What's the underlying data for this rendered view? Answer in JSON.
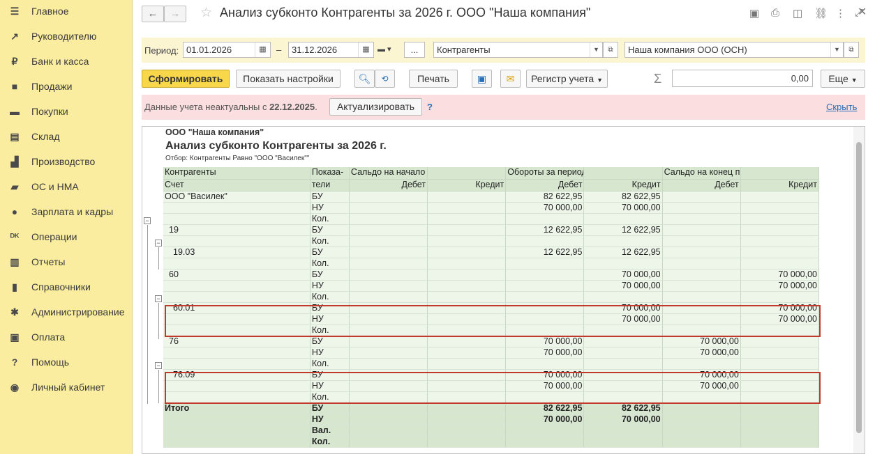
{
  "sidebar": {
    "items": [
      {
        "label": "Главное",
        "icon": "menu-icon"
      },
      {
        "label": "Руководителю",
        "icon": "trend-icon"
      },
      {
        "label": "Банк и касса",
        "icon": "ruble-icon"
      },
      {
        "label": "Продажи",
        "icon": "bag-icon"
      },
      {
        "label": "Покупки",
        "icon": "cart-icon"
      },
      {
        "label": "Склад",
        "icon": "warehouse-icon"
      },
      {
        "label": "Производство",
        "icon": "factory-icon"
      },
      {
        "label": "ОС и НМА",
        "icon": "truck-icon"
      },
      {
        "label": "Зарплата и кадры",
        "icon": "person-icon"
      },
      {
        "label": "Операции",
        "icon": "dt-kt-icon"
      },
      {
        "label": "Отчеты",
        "icon": "chart-icon"
      },
      {
        "label": "Справочники",
        "icon": "book-icon"
      },
      {
        "label": "Администрирование",
        "icon": "gear-icon"
      },
      {
        "label": "Оплата",
        "icon": "wallet-icon"
      },
      {
        "label": "Помощь",
        "icon": "question-icon"
      },
      {
        "label": "Личный кабинет",
        "icon": "account-icon"
      }
    ]
  },
  "header": {
    "title": "Анализ субконто Контрагенты за 2026 г. ООО \"Наша компания\"",
    "back": "←",
    "forward": "→"
  },
  "params": {
    "period_label": "Период:",
    "date_from": "01.01.2026",
    "dash": "–",
    "date_to": "31.12.2026",
    "more": "...",
    "subconto": "Контрагенты",
    "org": "Наша компания ООО (ОСН)"
  },
  "actions": {
    "form": "Сформировать",
    "settings": "Показать настройки",
    "print": "Печать",
    "register": "Регистр учета",
    "sum_sign": "Σ",
    "sum_value": "0,00",
    "more": "Еще"
  },
  "notice": {
    "text": "Данные учета неактуальны с ",
    "date": "22.12.2025",
    "tail": ".",
    "button": "Актуализировать",
    "help": "?",
    "hide": "Скрыть"
  },
  "report": {
    "org": "ООО \"Наша компания\"",
    "title": "Анализ субконто Контрагенты за 2026 г.",
    "filter": "Отбор: Контрагенты Равно \"ООО \"Василек\"\"",
    "head1": [
      "Контрагенты",
      "Показа-",
      "Сальдо на начало периода",
      "",
      "Обороты за период",
      "",
      "Сальдо на конец периода",
      ""
    ],
    "head2": [
      "Счет",
      "тели",
      "Дебет",
      "Кредит",
      "Дебет",
      "Кредит",
      "Дебет",
      "Кредит"
    ],
    "rows": [
      [
        "ООО \"Василек\"",
        "БУ",
        "",
        "",
        "82 622,95",
        "82 622,95",
        "",
        ""
      ],
      [
        "",
        "НУ",
        "",
        "",
        "70 000,00",
        "70 000,00",
        "",
        ""
      ],
      [
        "",
        "Кол.",
        "",
        "",
        "",
        "",
        "",
        ""
      ],
      [
        "19",
        "БУ",
        "",
        "",
        "12 622,95",
        "12 622,95",
        "",
        ""
      ],
      [
        "",
        "Кол.",
        "",
        "",
        "",
        "",
        "",
        ""
      ],
      [
        "19.03",
        "БУ",
        "",
        "",
        "12 622,95",
        "12 622,95",
        "",
        ""
      ],
      [
        "",
        "Кол.",
        "",
        "",
        "",
        "",
        "",
        ""
      ],
      [
        "60",
        "БУ",
        "",
        "",
        "",
        "70 000,00",
        "",
        "70 000,00"
      ],
      [
        "",
        "НУ",
        "",
        "",
        "",
        "70 000,00",
        "",
        "70 000,00"
      ],
      [
        "",
        "Кол.",
        "",
        "",
        "",
        "",
        "",
        ""
      ],
      [
        "60.01",
        "БУ",
        "",
        "",
        "",
        "70 000,00",
        "",
        "70 000,00"
      ],
      [
        "",
        "НУ",
        "",
        "",
        "",
        "70 000,00",
        "",
        "70 000,00"
      ],
      [
        "",
        "Кол.",
        "",
        "",
        "",
        "",
        "",
        ""
      ],
      [
        "76",
        "БУ",
        "",
        "",
        "70 000,00",
        "",
        "70 000,00",
        ""
      ],
      [
        "",
        "НУ",
        "",
        "",
        "70 000,00",
        "",
        "70 000,00",
        ""
      ],
      [
        "",
        "Кол.",
        "",
        "",
        "",
        "",
        "",
        ""
      ],
      [
        "76.09",
        "БУ",
        "",
        "",
        "70 000,00",
        "",
        "70 000,00",
        ""
      ],
      [
        "",
        "НУ",
        "",
        "",
        "70 000,00",
        "",
        "70 000,00",
        ""
      ],
      [
        "",
        "Кол.",
        "",
        "",
        "",
        "",
        "",
        ""
      ]
    ],
    "totals": [
      [
        "Итого",
        "БУ",
        "",
        "",
        "82 622,95",
        "82 622,95",
        "",
        ""
      ],
      [
        "",
        "НУ",
        "",
        "",
        "70 000,00",
        "70 000,00",
        "",
        ""
      ],
      [
        "",
        "Вал.",
        "",
        "",
        "",
        "",
        "",
        ""
      ],
      [
        "",
        "Кол.",
        "",
        "",
        "",
        "",
        "",
        ""
      ]
    ]
  }
}
